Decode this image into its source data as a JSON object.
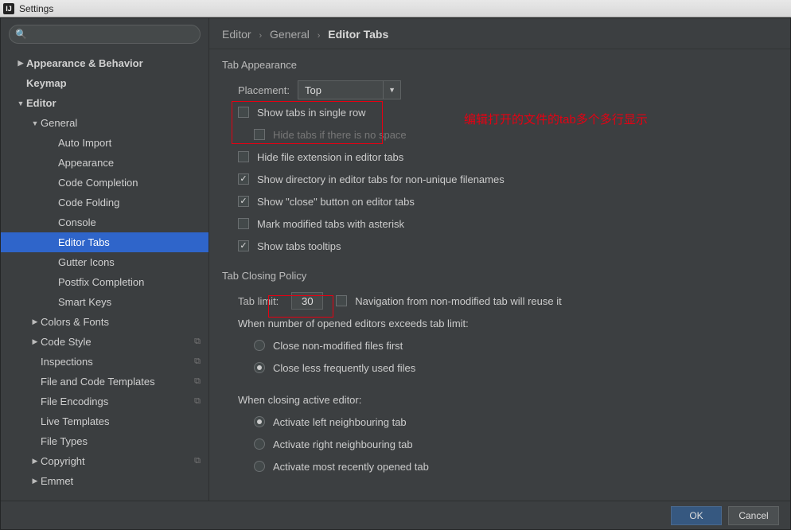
{
  "title": "Settings",
  "search_placeholder": "",
  "breadcrumb": {
    "a": "Editor",
    "b": "General",
    "c": "Editor Tabs"
  },
  "tree": [
    {
      "lvl": 0,
      "arrow": "right",
      "bold": true,
      "label": "Appearance & Behavior"
    },
    {
      "lvl": 0,
      "arrow": "none",
      "bold": true,
      "label": "Keymap"
    },
    {
      "lvl": 0,
      "arrow": "down",
      "bold": true,
      "label": "Editor"
    },
    {
      "lvl": 1,
      "arrow": "down",
      "bold": false,
      "label": "General"
    },
    {
      "lvl": 2,
      "arrow": "none",
      "bold": false,
      "label": "Auto Import"
    },
    {
      "lvl": 2,
      "arrow": "none",
      "bold": false,
      "label": "Appearance"
    },
    {
      "lvl": 2,
      "arrow": "none",
      "bold": false,
      "label": "Code Completion"
    },
    {
      "lvl": 2,
      "arrow": "none",
      "bold": false,
      "label": "Code Folding"
    },
    {
      "lvl": 2,
      "arrow": "none",
      "bold": false,
      "label": "Console"
    },
    {
      "lvl": 2,
      "arrow": "none",
      "bold": false,
      "label": "Editor Tabs",
      "sel": true
    },
    {
      "lvl": 2,
      "arrow": "none",
      "bold": false,
      "label": "Gutter Icons"
    },
    {
      "lvl": 2,
      "arrow": "none",
      "bold": false,
      "label": "Postfix Completion"
    },
    {
      "lvl": 2,
      "arrow": "none",
      "bold": false,
      "label": "Smart Keys"
    },
    {
      "lvl": 1,
      "arrow": "right",
      "bold": false,
      "label": "Colors & Fonts"
    },
    {
      "lvl": 1,
      "arrow": "right",
      "bold": false,
      "label": "Code Style",
      "copy": true
    },
    {
      "lvl": 1,
      "arrow": "none",
      "bold": false,
      "label": "Inspections",
      "copy": true
    },
    {
      "lvl": 1,
      "arrow": "none",
      "bold": false,
      "label": "File and Code Templates",
      "copy": true
    },
    {
      "lvl": 1,
      "arrow": "none",
      "bold": false,
      "label": "File Encodings",
      "copy": true
    },
    {
      "lvl": 1,
      "arrow": "none",
      "bold": false,
      "label": "Live Templates"
    },
    {
      "lvl": 1,
      "arrow": "none",
      "bold": false,
      "label": "File Types"
    },
    {
      "lvl": 1,
      "arrow": "right",
      "bold": false,
      "label": "Copyright",
      "copy": true
    },
    {
      "lvl": 1,
      "arrow": "right",
      "bold": false,
      "label": "Emmet"
    }
  ],
  "tabAppearance": {
    "title": "Tab Appearance",
    "placement_label": "Placement:",
    "placement_value": "Top",
    "singleRow": "Show tabs in single row",
    "hideNoSpace": "Hide tabs if there is no space",
    "hideExt": "Hide file extension in editor tabs",
    "showDir": "Show directory in editor tabs for non-unique filenames",
    "showClose": "Show \"close\" button on editor tabs",
    "markAsterisk": "Mark modified tabs with asterisk",
    "tooltips": "Show tabs tooltips"
  },
  "tabClosing": {
    "title": "Tab Closing Policy",
    "limit_label": "Tab limit:",
    "limit_value": "30",
    "navReuse": "Navigation from non-modified tab will reuse it",
    "exceed_label": "When number of opened editors exceeds tab limit:",
    "closeNonMod": "Close non-modified files first",
    "closeLess": "Close less frequently used files",
    "closingActive_label": "When closing active editor:",
    "actLeft": "Activate left neighbouring tab",
    "actRight": "Activate right neighbouring tab",
    "actRecent": "Activate most recently opened tab"
  },
  "annotation": "编辑打开的文件的tab多个多行显示",
  "buttons": {
    "ok": "OK",
    "cancel": "Cancel"
  }
}
